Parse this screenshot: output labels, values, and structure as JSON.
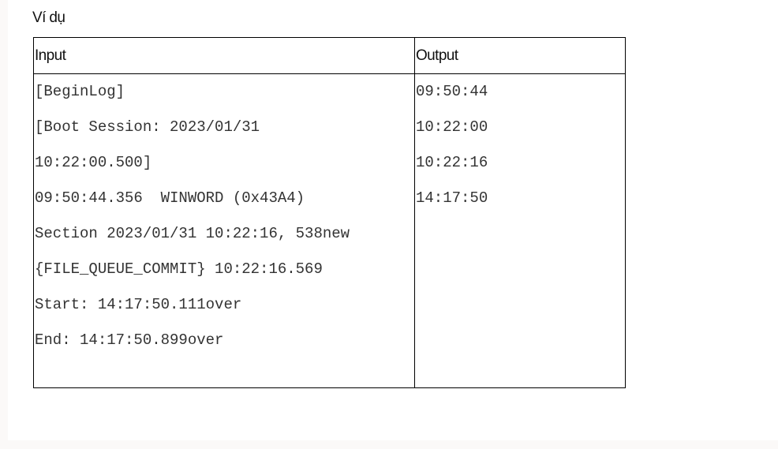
{
  "heading": "Ví dụ",
  "table": {
    "headers": {
      "input": "Input",
      "output": "Output"
    },
    "input_lines": [
      "[BeginLog]",
      "[Boot Session: 2023/01/31",
      "10:22:00.500]",
      "09:50:44.356  WINWORD (0x43A4)",
      "Section 2023/01/31 10:22:16, 538new",
      "{FILE_QUEUE_COMMIT} 10:22:16.569",
      "Start: 14:17:50.111over",
      "End: 14:17:50.899over"
    ],
    "output_lines": [
      "09:50:44",
      "10:22:00",
      "10:22:16",
      "14:17:50"
    ]
  }
}
